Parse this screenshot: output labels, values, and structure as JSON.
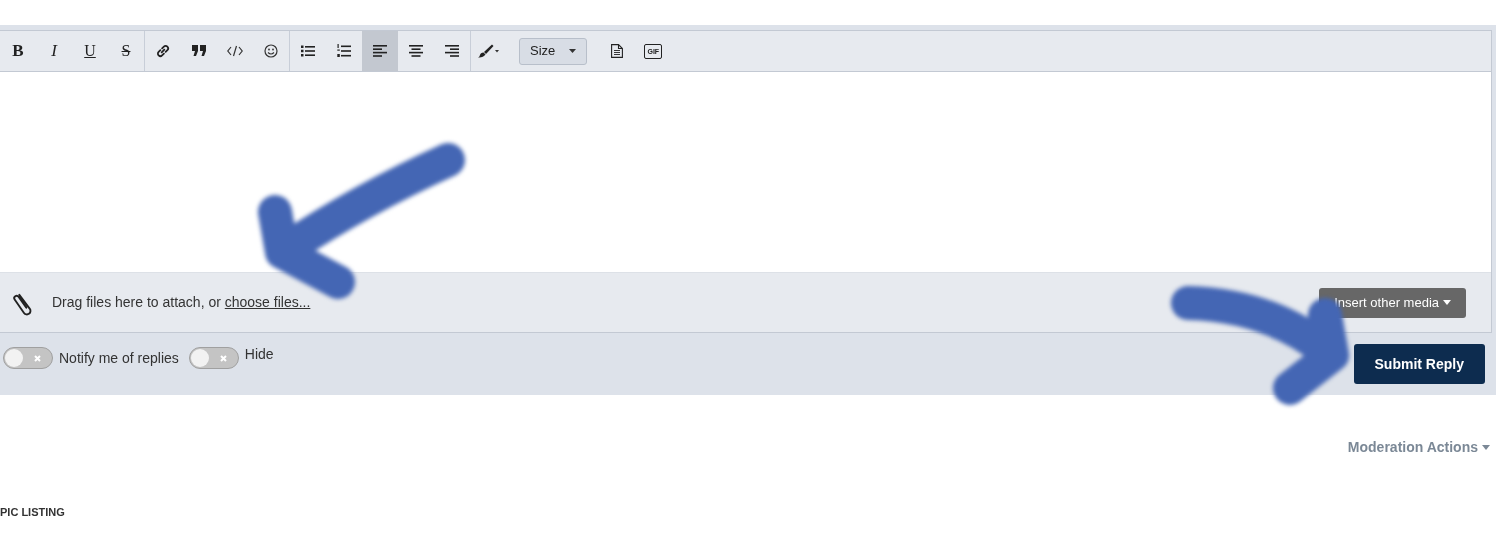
{
  "toolbar": {
    "groups": [
      {
        "buttons": [
          {
            "kind": "bold",
            "label": "B",
            "selected": false
          },
          {
            "kind": "italic",
            "label": "I",
            "selected": false
          },
          {
            "kind": "underline",
            "label": "U",
            "selected": false
          },
          {
            "kind": "strike",
            "label": "S",
            "selected": false
          }
        ]
      },
      {
        "buttons": [
          {
            "kind": "link",
            "selected": false
          },
          {
            "kind": "quote",
            "selected": false
          },
          {
            "kind": "code",
            "selected": false
          },
          {
            "kind": "smiley",
            "selected": false
          }
        ]
      },
      {
        "buttons": [
          {
            "kind": "bullet-list",
            "selected": false
          },
          {
            "kind": "numbered-list",
            "selected": false
          },
          {
            "kind": "align-left",
            "selected": true
          },
          {
            "kind": "align-center",
            "selected": false
          },
          {
            "kind": "align-right",
            "selected": false
          }
        ]
      },
      {
        "buttons": [
          {
            "kind": "brush",
            "selected": false
          },
          {
            "kind": "size",
            "label": "Size",
            "selected": false
          },
          {
            "kind": "document",
            "selected": false
          },
          {
            "kind": "gif",
            "label": "GIF",
            "selected": false
          }
        ]
      }
    ]
  },
  "attach": {
    "text": "Drag files here to attach, or ",
    "link": "choose files..."
  },
  "insert_media": "Insert other media",
  "options": [
    {
      "label": "Notify me of replies",
      "on": false
    },
    {
      "label": "Hide",
      "on": false
    }
  ],
  "submit": "Submit Reply",
  "moderation": "Moderation Actions",
  "section_heading": "PIC LISTING"
}
